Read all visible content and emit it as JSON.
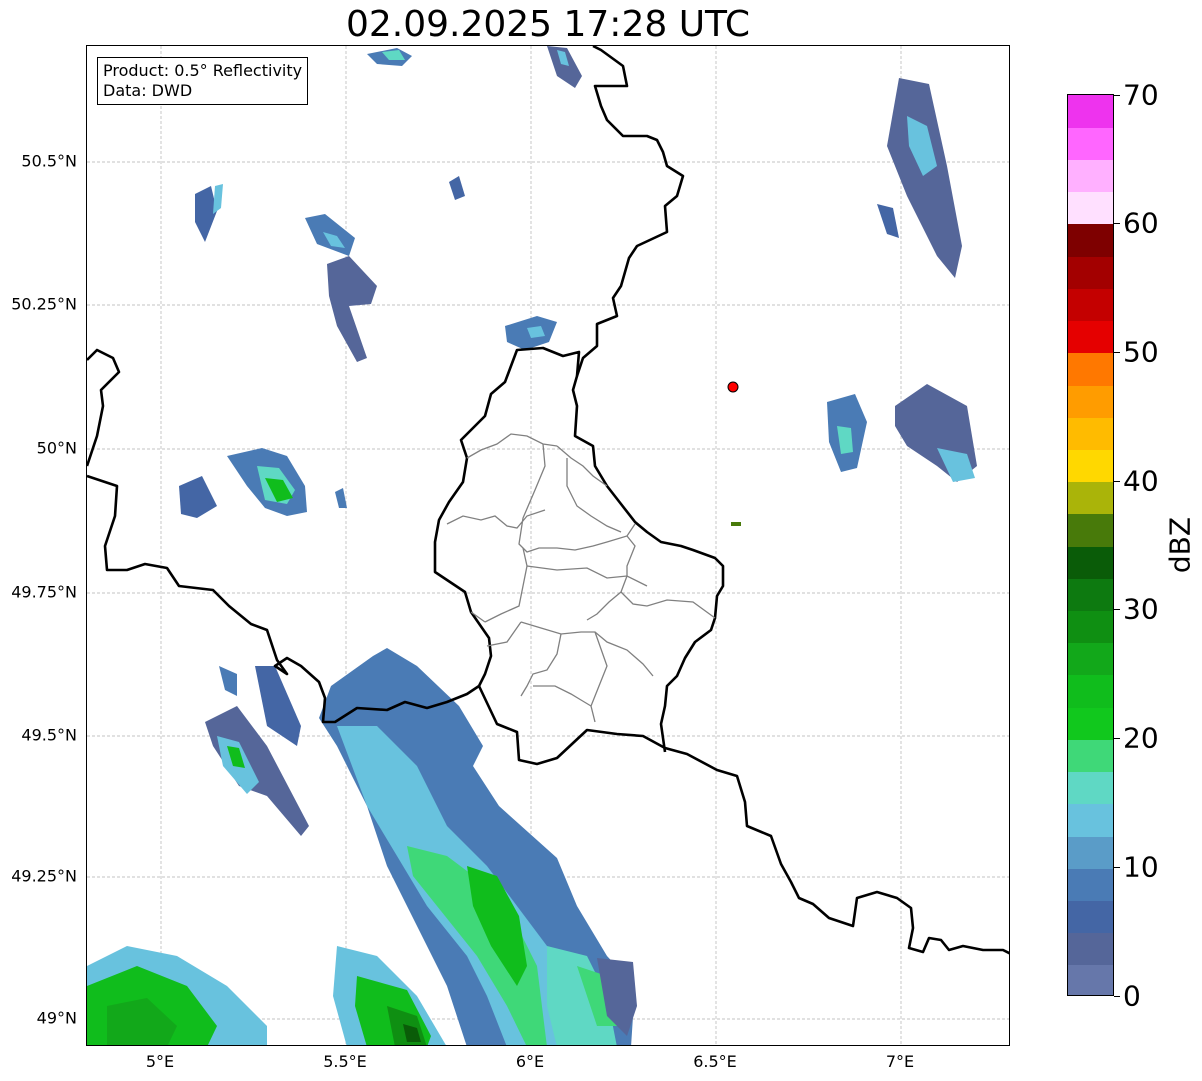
{
  "title": "02.09.2025 17:28 UTC",
  "info_box": {
    "product": "Product: 0.5° Reflectivity",
    "data": "Data: DWD"
  },
  "lat_labels": [
    "50.5°N",
    "50.25°N",
    "50°N",
    "49.75°N",
    "49.5°N",
    "49.25°N",
    "49°N"
  ],
  "lon_labels": [
    "5°E",
    "5.5°E",
    "6°E",
    "6.5°E",
    "7°E"
  ],
  "colorbar": {
    "unit": "dBZ",
    "tick_labels": [
      "0",
      "10",
      "20",
      "30",
      "40",
      "50",
      "60",
      "70"
    ],
    "colors": [
      "#6677aa",
      "#556699",
      "#4466a5",
      "#4a7bb5",
      "#5a9cc8",
      "#68c2de",
      "#5fd8c4",
      "#3fd878",
      "#11c81d",
      "#10bd1c",
      "#12a81a",
      "#0f8f12",
      "#0d7a10",
      "#0a5c08",
      "#487a0a",
      "#aab409",
      "#ffd800",
      "#ffbb00",
      "#ff9c00",
      "#ff7800",
      "#e50000",
      "#c40000",
      "#a30000",
      "#7e0000",
      "#ffe0ff",
      "#ffb0ff",
      "#ff66ff",
      "#ee33ee"
    ]
  },
  "radar_marker": {
    "color": "#ff0000"
  },
  "colors": {
    "border": "#000000",
    "district": "#808080",
    "grid": "#b0b0b0"
  }
}
